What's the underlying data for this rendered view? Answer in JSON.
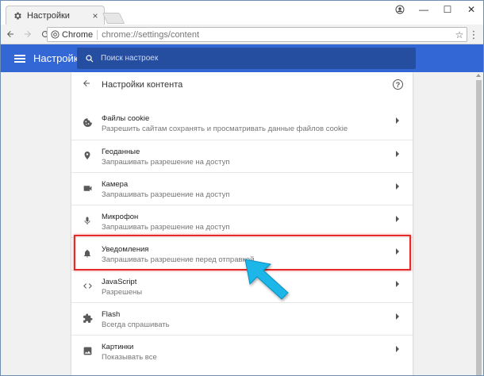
{
  "tab": {
    "title": "Настройки",
    "icon": "gear-icon",
    "close": "×"
  },
  "window": {
    "minimize": "—",
    "maximize": "☐",
    "close": "✕"
  },
  "toolbar": {
    "site_name": "Chrome",
    "url": "chrome://settings/content"
  },
  "header": {
    "title": "Настройки",
    "search_placeholder": "Поиск настроек"
  },
  "card": {
    "title": "Настройки контента"
  },
  "rows": [
    {
      "icon": "cookie-icon",
      "title": "Файлы cookie",
      "subtitle": "Разрешить сайтам сохранять и просматривать данные файлов cookie"
    },
    {
      "icon": "location-pin-icon",
      "title": "Геоданные",
      "subtitle": "Запрашивать разрешение на доступ"
    },
    {
      "icon": "camera-icon",
      "title": "Камера",
      "subtitle": "Запрашивать разрешение на доступ"
    },
    {
      "icon": "microphone-icon",
      "title": "Микрофон",
      "subtitle": "Запрашивать разрешение на доступ"
    },
    {
      "icon": "bell-icon",
      "title": "Уведомления",
      "subtitle": "Запрашивать разрешение перед отправкой"
    },
    {
      "icon": "code-icon",
      "title": "JavaScript",
      "subtitle": "Разрешены"
    },
    {
      "icon": "puzzle-icon",
      "title": "Flash",
      "subtitle": "Всегда спрашивать"
    },
    {
      "icon": "image-icon",
      "title": "Картинки",
      "subtitle": "Показывать все"
    }
  ],
  "colors": {
    "header": "#3367d6",
    "search": "#254ea0",
    "highlight": "#e52a2a",
    "arrow": "#1cb6e8"
  }
}
